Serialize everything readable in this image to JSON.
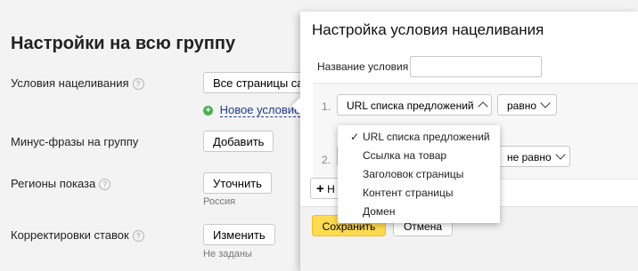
{
  "left": {
    "title": "Настройки на всю группу",
    "targeting": {
      "label": "Условия нацеливания",
      "value": "Все страницы сайт",
      "new_condition": "Новое условие"
    },
    "minus": {
      "label": "Минус-фразы на группу",
      "button": "Добавить"
    },
    "regions": {
      "label": "Регионы показа",
      "button": "Уточнить",
      "value": "Россия"
    },
    "bids": {
      "label": "Корректировки ставок",
      "button": "Изменить",
      "value": "Не заданы"
    }
  },
  "modal": {
    "title": "Настройка условия нацеливания",
    "name_label": "Название условия",
    "name_value": "",
    "rule1": {
      "num": "1.",
      "field": "URL списка предложений",
      "op": "равно"
    },
    "rule2": {
      "num": "2.",
      "op": "не равно"
    },
    "add_partial": "Н",
    "save": "Сохранить",
    "cancel": "Отмена"
  },
  "dropdown": {
    "check": "✓",
    "options": [
      "URL списка предложений",
      "Ссылка на товар",
      "Заголовок страницы",
      "Контент страницы",
      "Домен"
    ],
    "selected": "URL списка предложений"
  },
  "colors": {
    "accent_green": "#4caf50",
    "link_blue": "#1e3c8c",
    "save_yellow": "#ffdb4d"
  }
}
